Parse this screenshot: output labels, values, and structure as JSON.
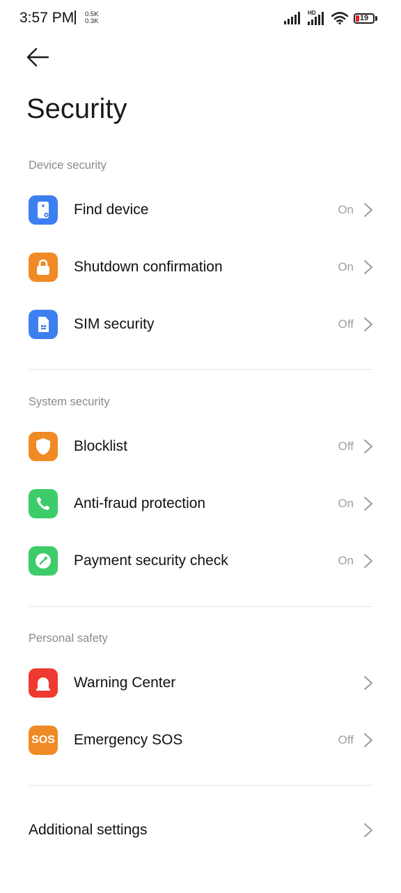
{
  "status_bar": {
    "time": "3:57 PM",
    "net_up": "0.5K",
    "net_down": "0.3K",
    "hd_label": "HD",
    "battery": "19",
    "battery_color": "#e02020"
  },
  "header": {
    "back_icon": "arrow-left-icon",
    "title": "Security"
  },
  "sections": [
    {
      "label": "Device security",
      "items": [
        {
          "label": "Find device",
          "value": "On",
          "icon": "find-device-icon",
          "color": "#3d7ff0"
        },
        {
          "label": "Shutdown confirmation",
          "value": "On",
          "icon": "lock-icon",
          "color": "#f08a24"
        },
        {
          "label": "SIM security",
          "value": "Off",
          "icon": "sim-card-icon",
          "color": "#3d7ff0"
        }
      ]
    },
    {
      "label": "System security",
      "items": [
        {
          "label": "Blocklist",
          "value": "Off",
          "icon": "shield-icon",
          "color": "#f08a24"
        },
        {
          "label": "Anti-fraud protection",
          "value": "On",
          "icon": "phone-icon",
          "color": "#3dcc6a"
        },
        {
          "label": "Payment security check",
          "value": "On",
          "icon": "compass-check-icon",
          "color": "#3dcc6a"
        }
      ]
    },
    {
      "label": "Personal safety",
      "items": [
        {
          "label": "Warning Center",
          "value": "",
          "icon": "alarm-icon",
          "color": "#ee3a30"
        },
        {
          "label": "Emergency SOS",
          "value": "Off",
          "icon": "sos-icon",
          "color": "#f08a24",
          "icon_text": "SOS"
        }
      ]
    }
  ],
  "additional_settings": {
    "label": "Additional settings"
  }
}
